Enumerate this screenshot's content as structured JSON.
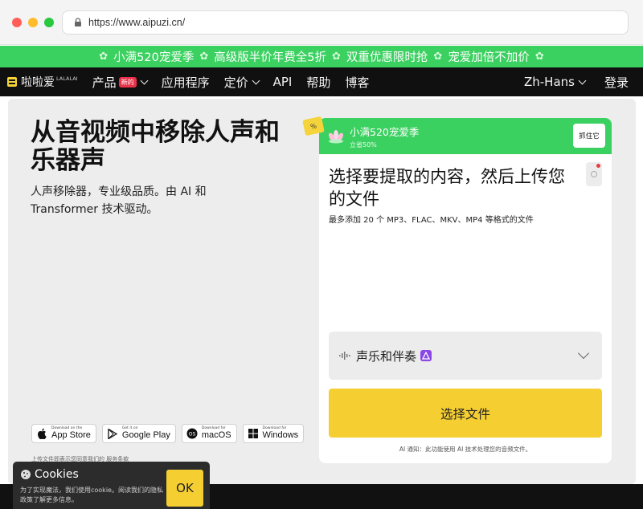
{
  "browser": {
    "url": "https://www.aipuzi.cn/"
  },
  "promo": {
    "items": [
      "小满520宠爱季",
      "高级版半价年费全5折",
      "双重优惠限时抢",
      "宠爱加倍不加价"
    ]
  },
  "nav": {
    "logo_text": "啦啦爱",
    "logo_sup": "LALALAI",
    "products": "产品",
    "new_badge": "新的",
    "apps": "应用程序",
    "pricing": "定价",
    "api": "API",
    "help": "帮助",
    "blog": "博客",
    "lang": "Zh-Hans",
    "login": "登录"
  },
  "hero": {
    "title": "从音视频中移除人声和乐器声",
    "subtitle": "人声移除器，专业级品质。由 AI 和 Transformer 技术驱动。"
  },
  "stores": [
    {
      "small": "Download on the",
      "big": "App Store",
      "icon": "apple-icon"
    },
    {
      "small": "Get it on",
      "big": "Google Play",
      "icon": "google-play-icon"
    },
    {
      "small": "Download for",
      "big": "macOS",
      "icon": "macos-icon"
    },
    {
      "small": "Download for",
      "big": "Windows",
      "icon": "windows-icon"
    }
  ],
  "terms": "上传文件即表示您同意我们的 服务条款",
  "badge_pct": "%",
  "card": {
    "promo_title": "小满520宠爱季",
    "promo_sub": "立省50%",
    "grab": "抓住它",
    "title": "选择要提取的内容，然后上传您的文件",
    "note": "最多添加 20 个 MP3、FLAC、MKV、MP4 等格式的文件",
    "selector_label": "声乐和伴奏",
    "choose_file": "选择文件",
    "ai_notice": "AI 通知：此功能使用 AI 技术处理您的音频文件。"
  },
  "cookie": {
    "title": "Cookies",
    "desc": "为了实现魔法，我们使用cookie。阅读我们的隐私政策了解更多信息。",
    "ok": "OK"
  },
  "colors": {
    "green": "#3bd160",
    "yellow": "#f5cf32",
    "dark": "#101010"
  }
}
